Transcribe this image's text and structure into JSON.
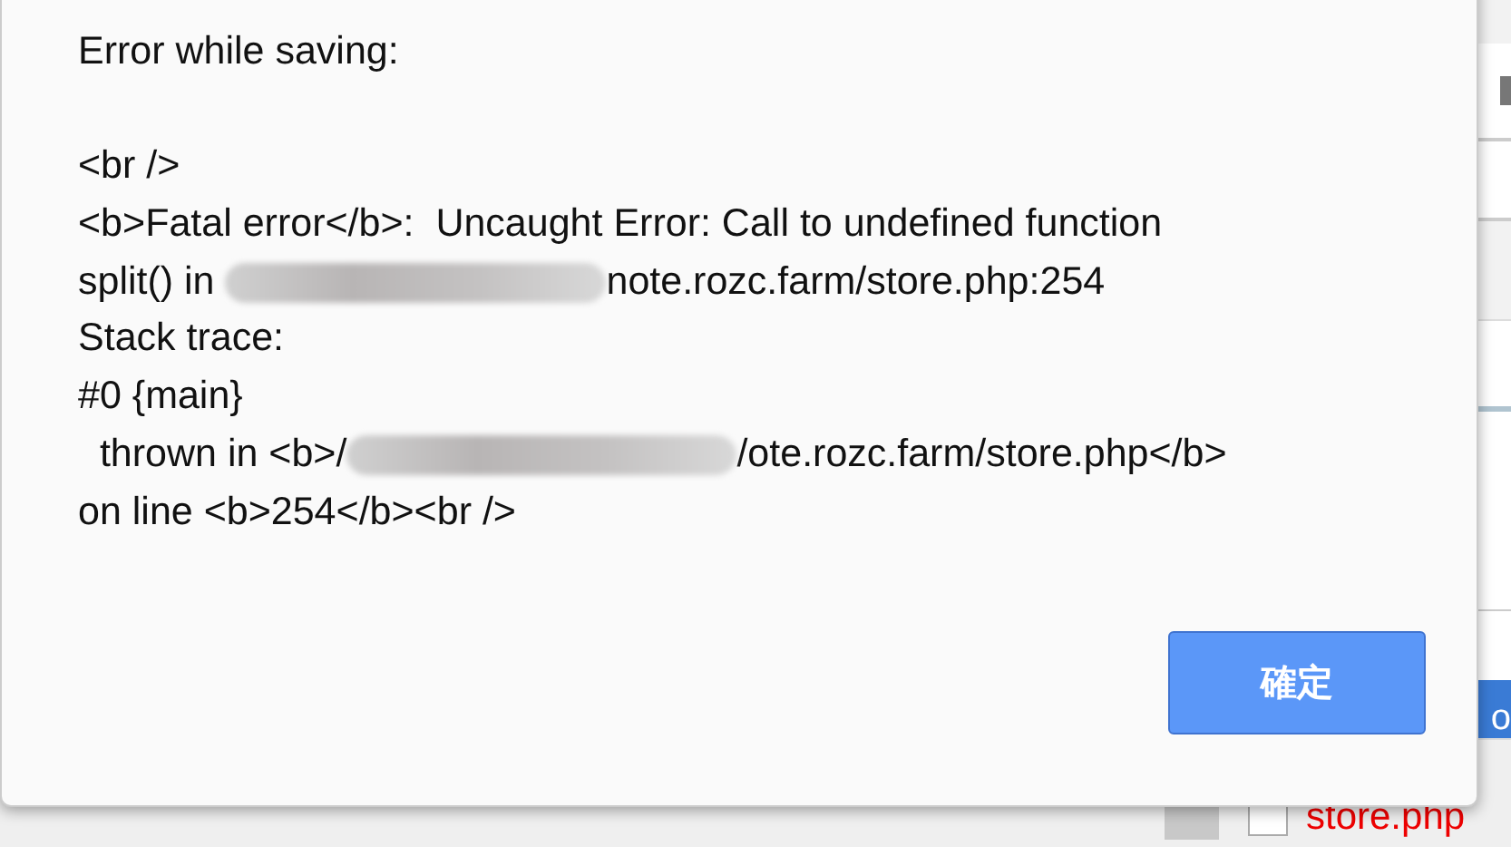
{
  "dialog": {
    "title": "Error while saving:",
    "lines": [
      {
        "kind": "plain",
        "text": "<br />"
      },
      {
        "kind": "plain",
        "text": "<b>Fatal error</b>:  Uncaught Error: Call to undefined function"
      },
      {
        "kind": "redacted",
        "text": "split() in ",
        "after": "note.rozc.farm/store.php:254"
      },
      {
        "kind": "plain",
        "text": "Stack trace:"
      },
      {
        "kind": "plain",
        "text": "#0 {main}"
      },
      {
        "kind": "redacted",
        "text": "  thrown in <b>/",
        "after": "/ote.rozc.farm/store.php</b>"
      },
      {
        "kind": "plain",
        "text": "on line <b>254</b><br />"
      }
    ],
    "ok_button": "確定"
  },
  "background": {
    "cut_button": "o",
    "file": {
      "name": "store.php",
      "checked": false
    }
  }
}
